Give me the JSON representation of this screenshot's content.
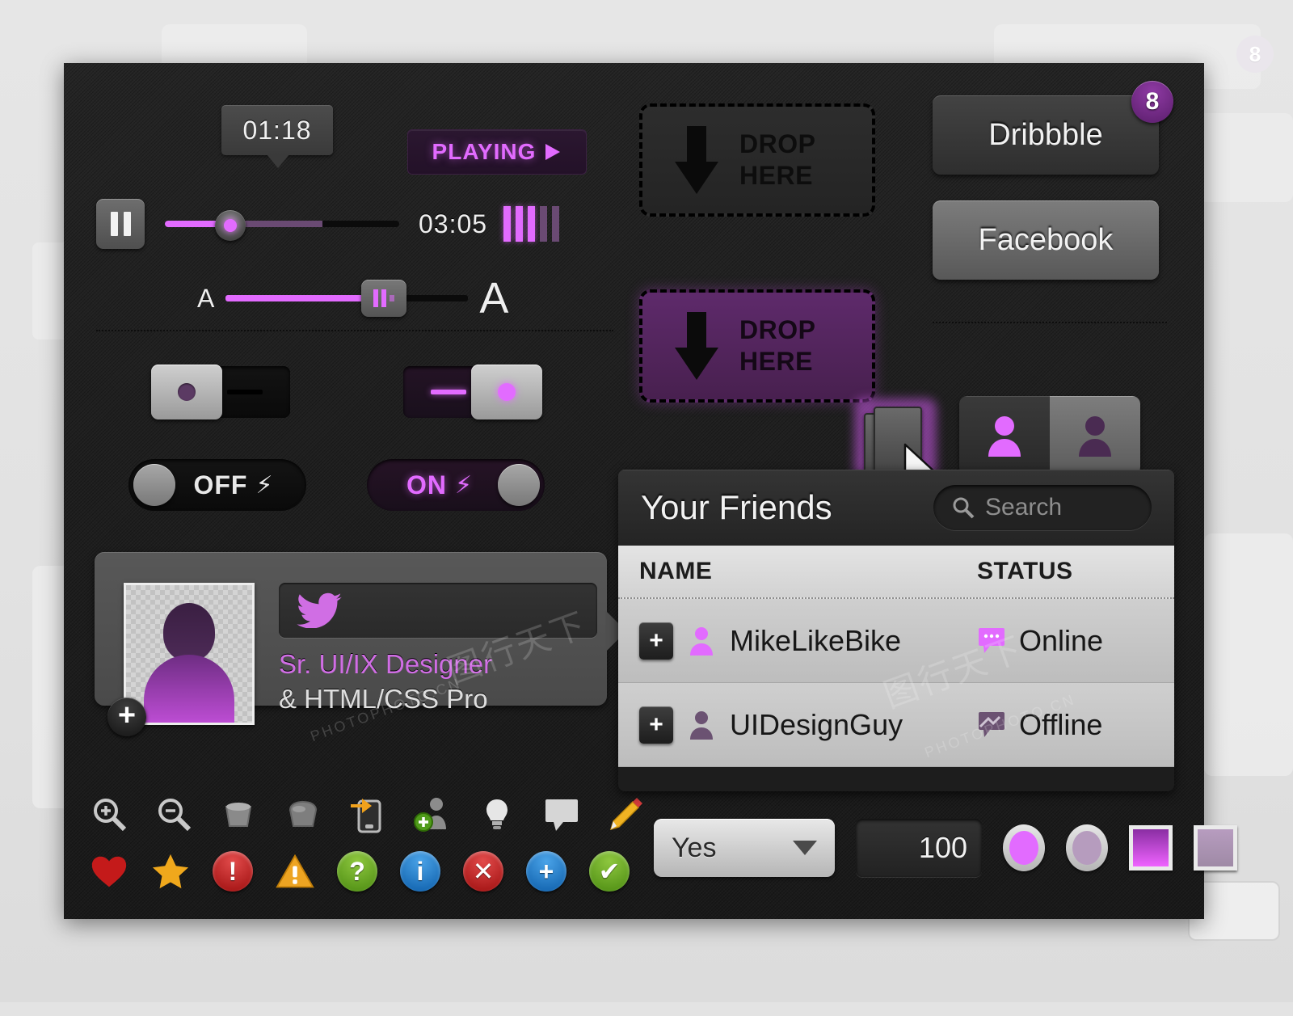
{
  "player": {
    "current_time": "01:18",
    "total_time": "03:05",
    "status_label": "PLAYING",
    "status_icon": "play-triangle",
    "pause_icon": "pause-icon",
    "signal_bars_total": 5,
    "signal_bars_active": 3,
    "font_small_label": "A",
    "font_large_label": "A"
  },
  "toggles": {
    "rocker_off_state": "off",
    "rocker_on_state": "on",
    "pill_off_label": "OFF",
    "pill_on_label": "ON",
    "bolt_glyph": "⚡"
  },
  "profile": {
    "job_line1": "Sr. UI/IX Designer",
    "job_line2": "& HTML/CSS Pro",
    "add_glyph": "+",
    "twitter_icon": "twitter-bird-icon"
  },
  "dropzones": [
    {
      "line1": "DROP",
      "line2": "HERE",
      "state": "idle"
    },
    {
      "line1": "DROP",
      "line2": "HERE",
      "state": "active"
    }
  ],
  "social": {
    "dribbble_label": "Dribbble",
    "dribbble_badge": "8",
    "facebook_label": "Facebook"
  },
  "friends": {
    "title": "Your Friends",
    "search_placeholder": "Search",
    "columns": {
      "name": "NAME",
      "status": "STATUS"
    },
    "rows": [
      {
        "add": "+",
        "name": "MikeLikeBike",
        "status": "Online",
        "state": "online"
      },
      {
        "add": "+",
        "name": "UIDesignGuy",
        "status": "Offline",
        "state": "offline"
      }
    ]
  },
  "bottom_controls": {
    "select_value": "Yes",
    "number_value": "100",
    "radio_selected": true,
    "radio_unselected": false
  },
  "icon_row_tools": [
    "zoom-in-icon",
    "zoom-out-icon",
    "bucket-empty-icon",
    "bucket-fill-icon",
    "mobile-share-icon",
    "add-user-icon",
    "lightbulb-icon",
    "comment-icon",
    "pencil-icon"
  ],
  "icon_row_badges": [
    "heart-icon",
    "star-icon",
    "error-icon",
    "warning-icon",
    "help-icon",
    "info-icon",
    "close-icon",
    "add-icon",
    "check-icon"
  ],
  "badge_labels": {
    "error": "!",
    "warning": "!",
    "help": "?",
    "info": "i",
    "close": "✕",
    "add": "+",
    "check": "✔"
  },
  "background": {
    "ghost_badge": "8"
  },
  "colors": {
    "accent": "#e26bff",
    "accent_dim": "#6a4a73",
    "panel_bg": "#1f1f1f",
    "page_bg": "#e3e3e3",
    "badge_purple": "#8f3aa4"
  },
  "watermark": {
    "text1": "PHOTOPHOTO.CN",
    "text2": "图行天下"
  }
}
